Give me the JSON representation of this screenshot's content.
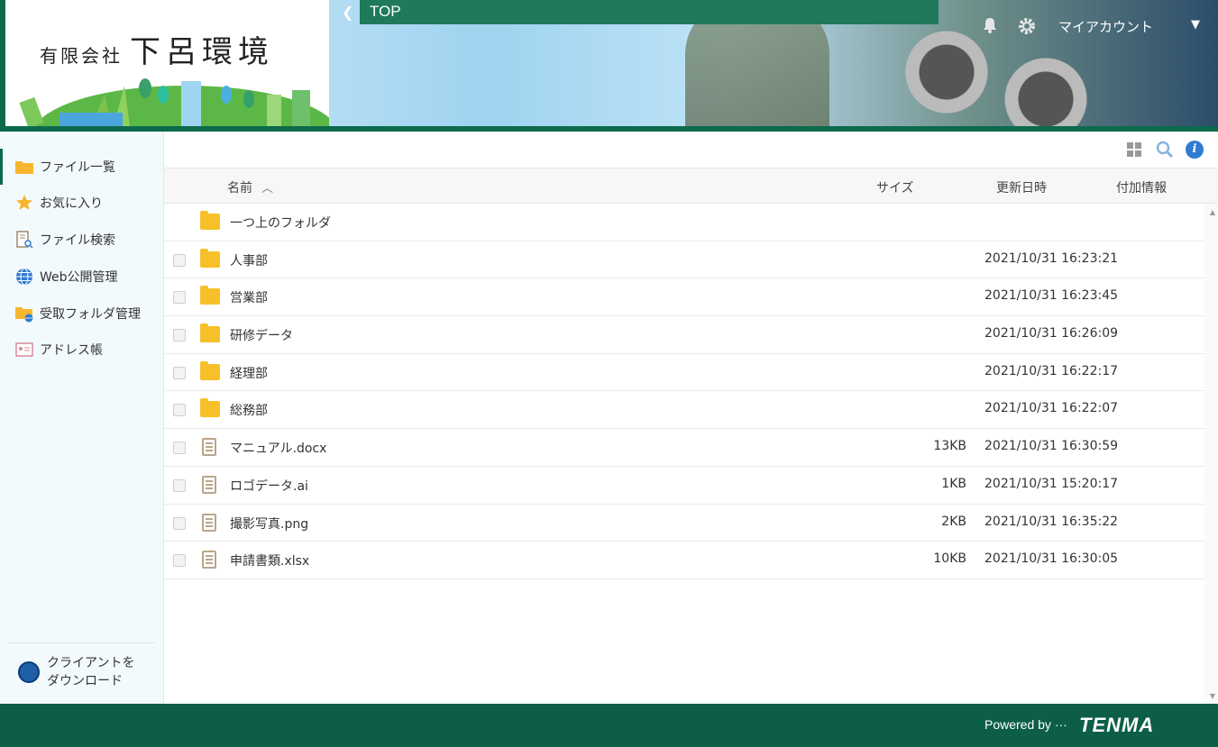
{
  "header": {
    "company_small": "有限会社",
    "company_big": "下呂環境",
    "breadcrumb": "TOP",
    "account_label": "マイアカウント"
  },
  "sidebar": {
    "items": [
      {
        "label": "ファイル一覧",
        "icon": "folder-icon"
      },
      {
        "label": "お気に入り",
        "icon": "star-icon"
      },
      {
        "label": "ファイル検索",
        "icon": "file-search-icon"
      },
      {
        "label": "Web公開管理",
        "icon": "globe-icon"
      },
      {
        "label": "受取フォルダ管理",
        "icon": "inbox-folder-icon"
      },
      {
        "label": "アドレス帳",
        "icon": "address-book-icon"
      }
    ],
    "client_download_line1": "クライアントを",
    "client_download_line2": "ダウンロード"
  },
  "table": {
    "headers": {
      "name": "名前",
      "size": "サイズ",
      "date": "更新日時",
      "extra": "付加情報"
    },
    "parent_folder": "一つ上のフォルダ",
    "rows": [
      {
        "type": "folder",
        "name": "人事部",
        "size": "",
        "date": "2021/10/31 16:23:21"
      },
      {
        "type": "folder",
        "name": "営業部",
        "size": "",
        "date": "2021/10/31 16:23:45"
      },
      {
        "type": "folder",
        "name": "研修データ",
        "size": "",
        "date": "2021/10/31 16:26:09"
      },
      {
        "type": "folder",
        "name": "経理部",
        "size": "",
        "date": "2021/10/31 16:22:17"
      },
      {
        "type": "folder",
        "name": "総務部",
        "size": "",
        "date": "2021/10/31 16:22:07"
      },
      {
        "type": "file",
        "name": "マニュアル.docx",
        "size": "13KB",
        "date": "2021/10/31 16:30:59"
      },
      {
        "type": "file",
        "name": "ロゴデータ.ai",
        "size": "1KB",
        "date": "2021/10/31 15:20:17"
      },
      {
        "type": "file",
        "name": "撮影写真.png",
        "size": "2KB",
        "date": "2021/10/31 16:35:22"
      },
      {
        "type": "file",
        "name": "申請書類.xlsx",
        "size": "10KB",
        "date": "2021/10/31 16:30:05"
      }
    ]
  },
  "footer": {
    "powered_by": "Powered by ···",
    "brand": "TENMA"
  },
  "colors": {
    "brand_green": "#0c6a4c",
    "folder_yellow": "#f7c02a",
    "sidebar_bg": "#f3fafd"
  }
}
